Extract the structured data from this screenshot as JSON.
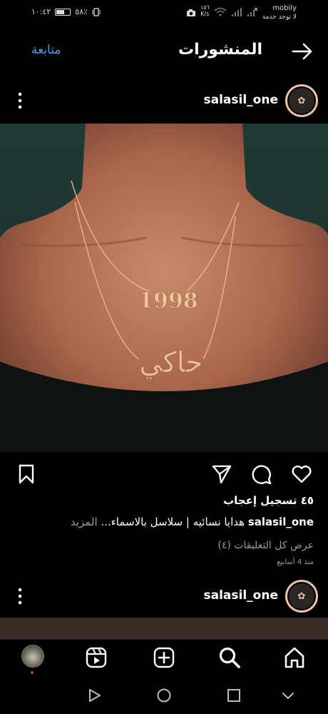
{
  "status_bar": {
    "time": "١٠:٤٢",
    "battery": "٥٨٪",
    "carrier": "mobily",
    "no_service": "لا توجد خدمة",
    "speed_value": "١٥٦",
    "speed_unit": "K/s"
  },
  "header": {
    "title": "المنشورات",
    "follow_label": "متابعة",
    "back_icon": "arrow-right-icon"
  },
  "post": {
    "username": "salasil_one",
    "image_alt": "necklace-photo",
    "pendant_year": "1998",
    "pendant_name": "حاكي",
    "likes": "٤٥ تسجيل إعجاب",
    "caption_user": "salasil_one",
    "caption_text": "هدايا نسائيه | سلاسل بالاسماء...",
    "caption_more": "المزيد",
    "view_comments": "عرض كل التعليقات (٤)",
    "timestamp": "منذ 4 أسابيع"
  },
  "next_post": {
    "username": "salasil_one"
  },
  "bottom_nav": {
    "items": [
      "home-icon",
      "search-icon",
      "new-post-icon",
      "reels-icon",
      "profile-avatar"
    ]
  },
  "colors": {
    "background": "#000000",
    "link": "#4a9fe8",
    "secondary_text": "#9a9a9a",
    "gold": "#e8b48a"
  }
}
